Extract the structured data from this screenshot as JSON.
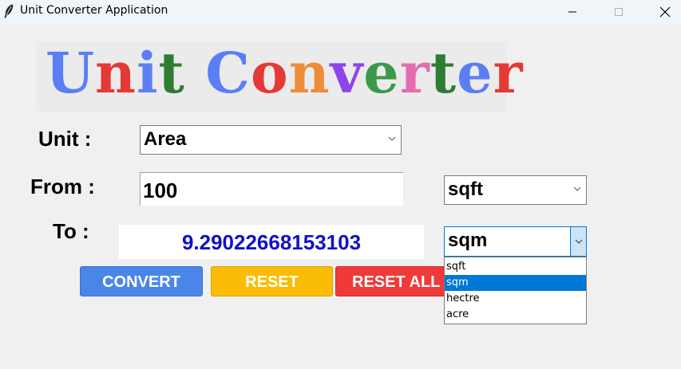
{
  "window": {
    "title": "Unit Converter Application",
    "icon": "feather-icon"
  },
  "banner": {
    "letters": [
      {
        "ch": "U",
        "color": "#5b7ef5"
      },
      {
        "ch": "n",
        "color": "#e53935"
      },
      {
        "ch": "i",
        "color": "#5b7ef5"
      },
      {
        "ch": "t",
        "color": "#2e7d32"
      },
      {
        "ch": " ",
        "color": "#000000"
      },
      {
        "ch": "C",
        "color": "#5b7ef5"
      },
      {
        "ch": "o",
        "color": "#e53935"
      },
      {
        "ch": "n",
        "color": "#ef8c3a"
      },
      {
        "ch": "v",
        "color": "#8e44ec"
      },
      {
        "ch": "e",
        "color": "#3a9a4a"
      },
      {
        "ch": "r",
        "color": "#e36cb0"
      },
      {
        "ch": "t",
        "color": "#2e7d32"
      },
      {
        "ch": "e",
        "color": "#5b7ef5"
      },
      {
        "ch": "r",
        "color": "#e53935"
      }
    ]
  },
  "labels": {
    "unit": "Unit :",
    "from": "From :",
    "to": "To :"
  },
  "unit_select": {
    "value": "Area"
  },
  "from_input": {
    "value": "100"
  },
  "from_unit_select": {
    "value": "sqft"
  },
  "to_unit_select": {
    "value": "sqm",
    "options": [
      "sqft",
      "sqm",
      "hectre",
      "acre"
    ],
    "selected_index": 1
  },
  "result": {
    "value": "9.29022668153103"
  },
  "buttons": {
    "convert": "CONVERT",
    "reset": "RESET",
    "reset_all": "RESET ALL"
  },
  "colors": {
    "convert": "#4a86e8",
    "reset": "#fbbc05",
    "reset_all": "#f03a3a",
    "result_text": "#1010cc",
    "selection": "#0078d7"
  }
}
